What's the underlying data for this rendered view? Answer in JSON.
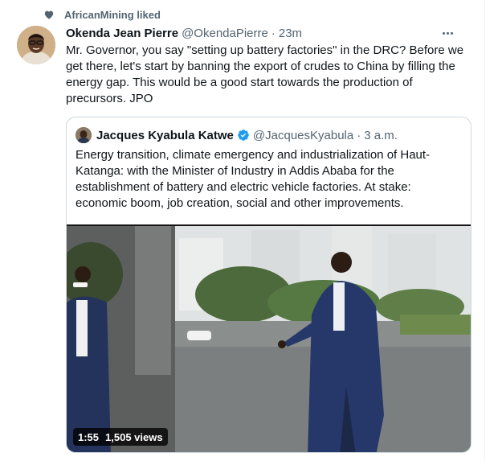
{
  "social_context": {
    "text": "AfricanMining liked",
    "icon": "heart-icon"
  },
  "tweet": {
    "author_name": "Okenda Jean Pierre",
    "author_handle": "@OkendaPierre",
    "separator": "·",
    "time": "23m",
    "text": "Mr. Governor, you say \"setting up battery factories\" in the DRC? Before we get there, let's start by banning the export of crudes to China by filling the energy gap. This would be a good start towards the production of precursors. JPO"
  },
  "quoted_tweet": {
    "author_name": "Jacques Kyabula Katwe",
    "verified": true,
    "author_handle": "@JacquesKyabula",
    "separator": "·",
    "time": "3 a.m.",
    "text": "Energy transition, climate emergency and industrialization of Haut-Katanga: with the Minister of Industry in Addis Ababa for the establishment of battery and electric vehicle factories. At stake: economic boom, job creation, social and other improvements."
  },
  "video": {
    "duration": "1:55",
    "views": "1,505 views"
  },
  "colors": {
    "text_primary": "#0f1419",
    "text_secondary": "#536471",
    "verified_blue": "#1d9bf0",
    "border": "#cfd9de"
  }
}
